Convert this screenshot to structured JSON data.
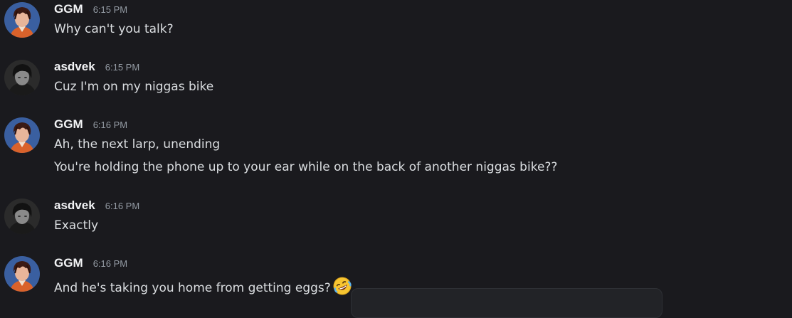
{
  "messages": [
    {
      "author": "GGM",
      "time": "6:15 PM",
      "avatar": "ggm-avatar",
      "lines": [
        "Why can't you talk?"
      ]
    },
    {
      "author": "asdvek",
      "time": "6:15 PM",
      "avatar": "asdvek-avatar",
      "lines": [
        "Cuz I'm on my niggas bike"
      ]
    },
    {
      "author": "GGM",
      "time": "6:16 PM",
      "avatar": "ggm-avatar",
      "lines": [
        "Ah, the next larp, unending",
        "You're holding the phone up to your ear while on the back of another niggas bike??"
      ]
    },
    {
      "author": "asdvek",
      "time": "6:16 PM",
      "avatar": "asdvek-avatar",
      "lines": [
        "Exactly"
      ]
    },
    {
      "author": "GGM",
      "time": "6:16 PM",
      "avatar": "ggm-avatar",
      "lines": [
        "And he's taking you home from getting eggs?"
      ],
      "emoji": "rolling-on-floor-laughing-emoji"
    }
  ],
  "colors": {
    "background": "#1a1a1e",
    "username": "#f2f3f5",
    "timestamp": "#949ba4",
    "text": "#dbdee1"
  }
}
